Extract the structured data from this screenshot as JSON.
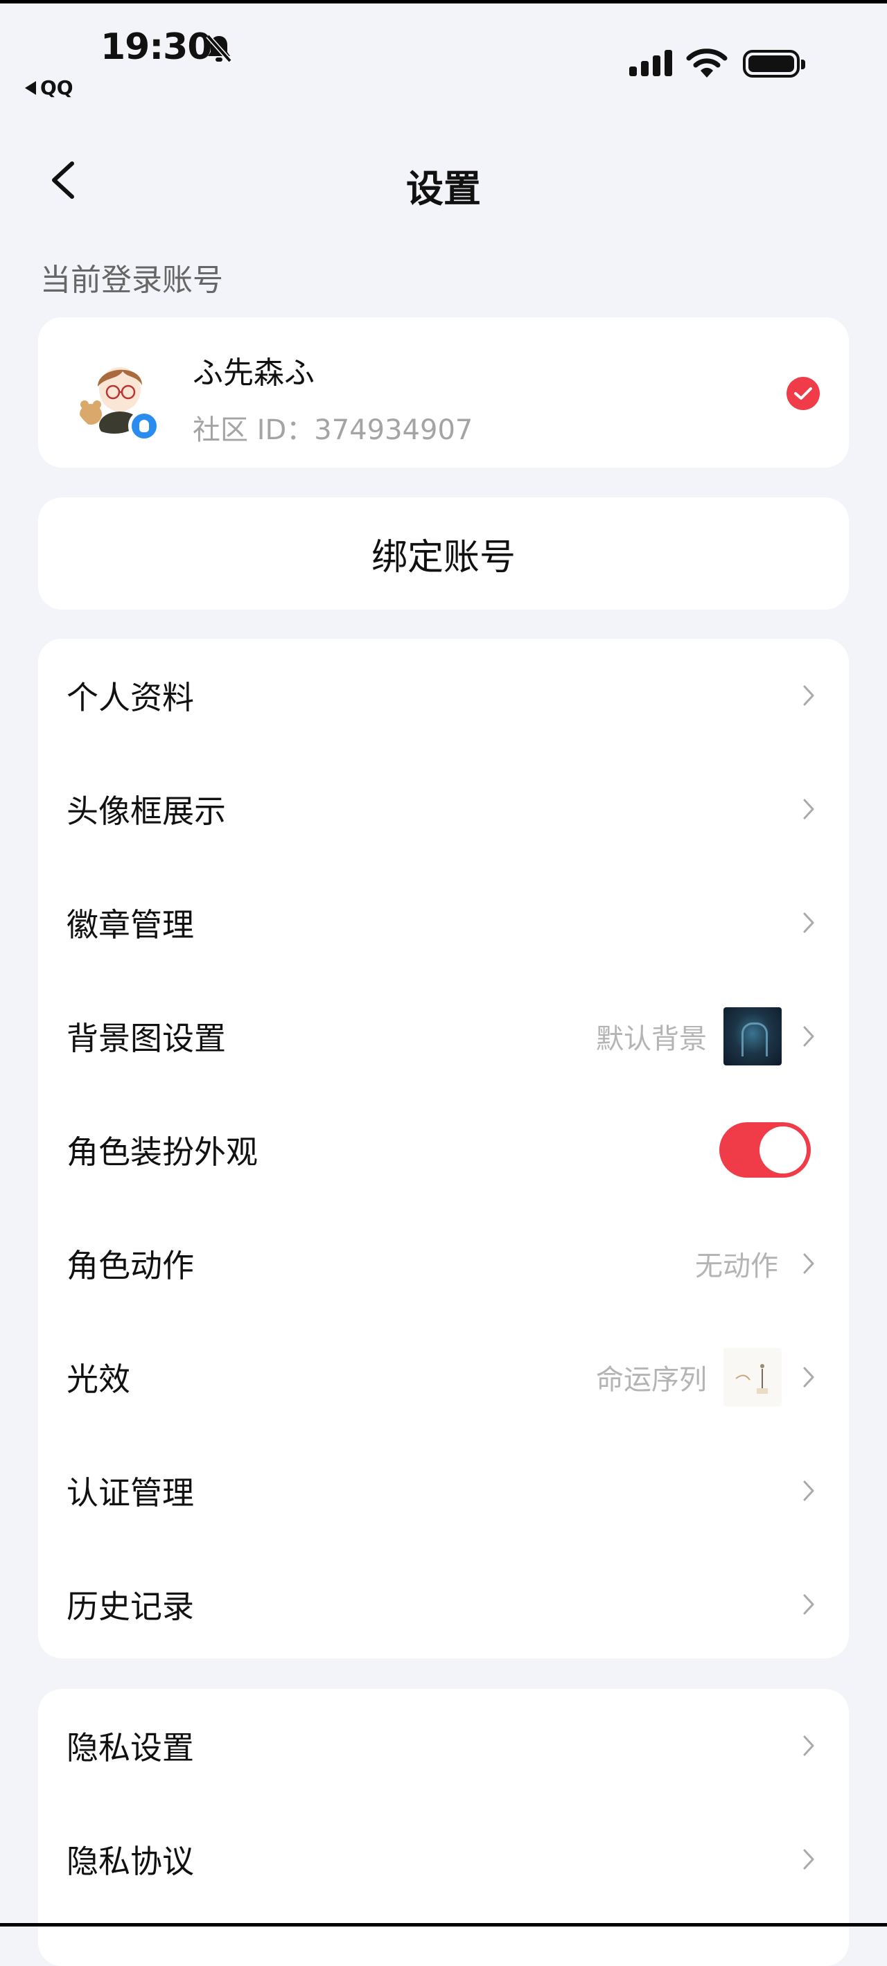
{
  "status_bar": {
    "time": "19:30",
    "back_app": "QQ",
    "icons": [
      "bell-slash-icon",
      "signal-icon",
      "wifi-icon",
      "battery-icon"
    ]
  },
  "nav": {
    "back_icon": "chevron-left-icon",
    "title": "设置"
  },
  "account_section": {
    "label": "当前登录账号",
    "name": "ふ先森ふ",
    "id_text": "社区 ID：374934907",
    "selected": true
  },
  "bind": {
    "label": "绑定账号"
  },
  "menu": {
    "profile": "个人资料",
    "avatar_frame": "头像框展示",
    "badges": "徽章管理",
    "background": {
      "label": "背景图设置",
      "value": "默认背景"
    },
    "appearance": {
      "label": "角色装扮外观",
      "enabled": true
    },
    "action": {
      "label": "角色动作",
      "value": "无动作"
    },
    "light_effect": {
      "label": "光效",
      "value": "命运序列"
    },
    "verification": "认证管理",
    "history": "历史记录",
    "privacy_settings": "隐私设置",
    "privacy_policy": "隐私协议"
  },
  "colors": {
    "accent": "#f03b48",
    "background": "#f3f4f9",
    "qq_blue": "#2b8cf0",
    "muted_text": "#a4a4a4"
  }
}
